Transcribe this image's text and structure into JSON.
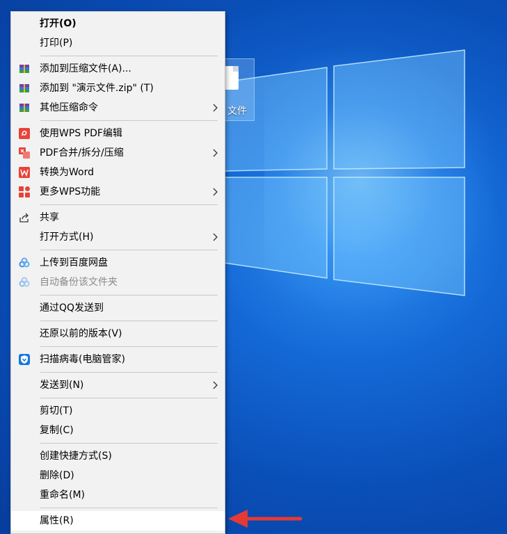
{
  "desktop": {
    "file_icon_label": "文件"
  },
  "menu": {
    "items": [
      {
        "label": "打开(O)"
      },
      {
        "label": "打印(P)"
      },
      {
        "label": "添加到压缩文件(A)..."
      },
      {
        "label": "添加到 \"演示文件.zip\" (T)"
      },
      {
        "label": "其他压缩命令"
      },
      {
        "label": "使用WPS PDF编辑"
      },
      {
        "label": "PDF合并/拆分/压缩"
      },
      {
        "label": "转换为Word"
      },
      {
        "label": "更多WPS功能"
      },
      {
        "label": "共享"
      },
      {
        "label": "打开方式(H)"
      },
      {
        "label": "上传到百度网盘"
      },
      {
        "label": "自动备份该文件夹"
      },
      {
        "label": "通过QQ发送到"
      },
      {
        "label": "还原以前的版本(V)"
      },
      {
        "label": "扫描病毒(电脑管家)"
      },
      {
        "label": "发送到(N)"
      },
      {
        "label": "剪切(T)"
      },
      {
        "label": "复制(C)"
      },
      {
        "label": "创建快捷方式(S)"
      },
      {
        "label": "删除(D)"
      },
      {
        "label": "重命名(M)"
      },
      {
        "label": "属性(R)"
      }
    ]
  },
  "colors": {
    "accent_arrow": "#e53935",
    "wps_red": "#e8433a",
    "baidu_blue": "#3b8fe6"
  }
}
